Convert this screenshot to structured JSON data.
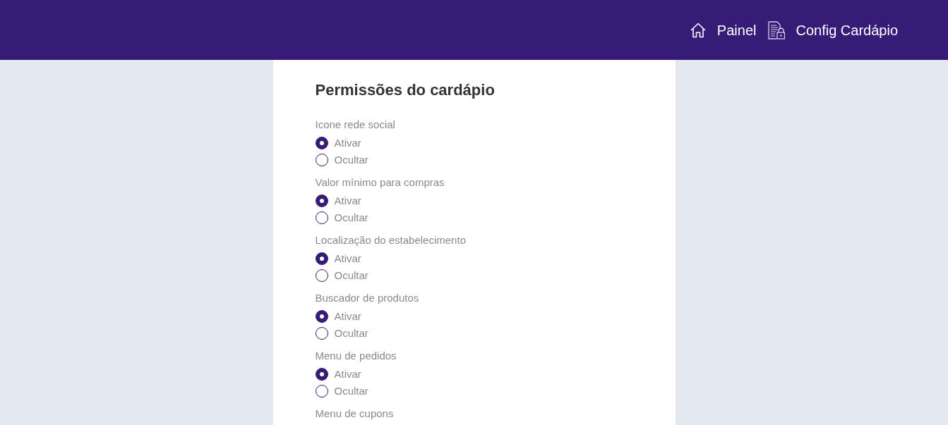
{
  "header": {
    "nav": [
      {
        "kind": "dashboard",
        "label": "Painel"
      },
      {
        "kind": "settings",
        "label": "Config Cardápio"
      }
    ]
  },
  "panel": {
    "title": "Permissões do cardápio",
    "groups": [
      {
        "label": "Icone rede social",
        "options": [
          {
            "label": "Ativar",
            "selected": true
          },
          {
            "label": "Ocultar",
            "selected": false
          }
        ]
      },
      {
        "label": "Valor mínimo para compras",
        "options": [
          {
            "label": "Ativar",
            "selected": true
          },
          {
            "label": "Ocultar",
            "selected": false
          }
        ]
      },
      {
        "label": "Localização do estabelecimento",
        "options": [
          {
            "label": "Ativar",
            "selected": true
          },
          {
            "label": "Ocultar",
            "selected": false
          }
        ]
      },
      {
        "label": "Buscador de produtos",
        "options": [
          {
            "label": "Ativar",
            "selected": true
          },
          {
            "label": "Ocultar",
            "selected": false
          }
        ]
      },
      {
        "label": "Menu de pedidos",
        "options": [
          {
            "label": "Ativar",
            "selected": true
          },
          {
            "label": "Ocultar",
            "selected": false
          }
        ]
      },
      {
        "label": "Menu de cupons"
      }
    ]
  }
}
